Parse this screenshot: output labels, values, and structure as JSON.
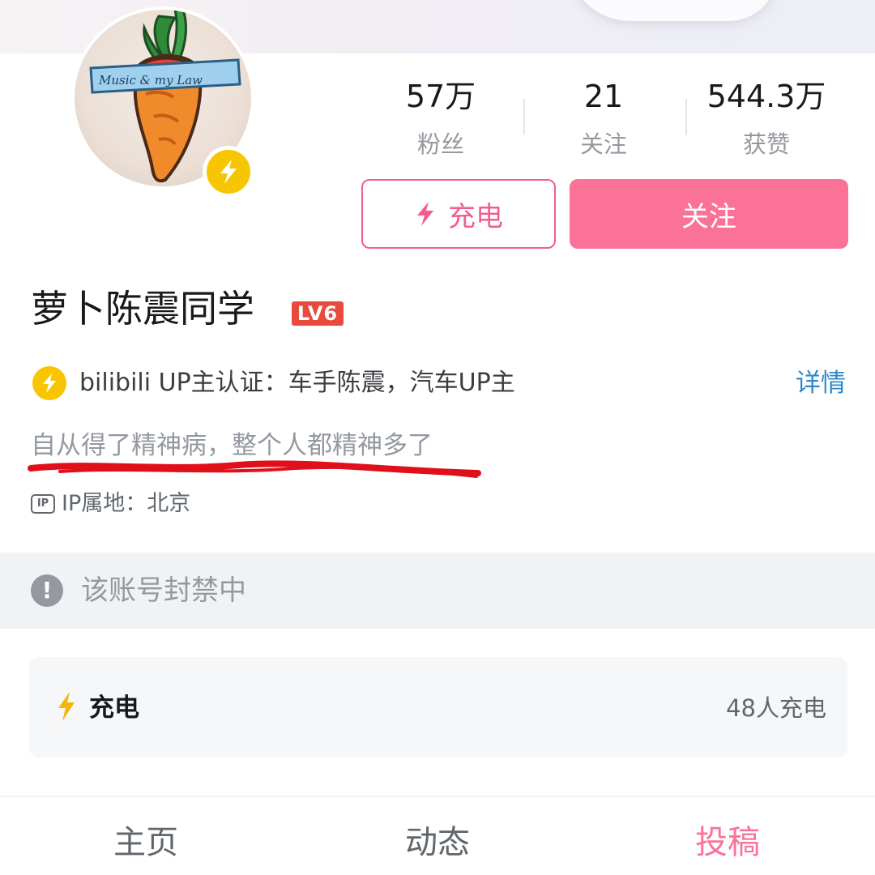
{
  "stats": [
    {
      "value": "57万",
      "label": "粉丝"
    },
    {
      "value": "21",
      "label": "关注"
    },
    {
      "value": "544.3万",
      "label": "获赞"
    }
  ],
  "actions": {
    "charge_label": "充电",
    "follow_label": "关注"
  },
  "profile": {
    "name": "萝卜陈震同学",
    "level": "LV6",
    "verification": "bilibili UP主认证：车手陈震，汽车UP主",
    "details_link": "详情",
    "signature": "自从得了精神病，整个人都精神多了",
    "ip_badge": "IP",
    "ip_location": "IP属地：北京",
    "avatar_text": "Music & my Law"
  },
  "notice": {
    "banned_text": "该账号封禁中",
    "icon": "exclamation-icon"
  },
  "charge_card": {
    "title": "充电",
    "count_text": "48人充电"
  },
  "tabs": [
    {
      "label": "主页",
      "active": false
    },
    {
      "label": "动态",
      "active": false
    },
    {
      "label": "投稿",
      "active": true
    }
  ],
  "colors": {
    "pink": "#fb7299",
    "pink_border": "#f25d8e",
    "link_blue": "#2e88c9",
    "gold": "#f7c600",
    "level_red": "#e94a3e",
    "annotation_red": "#e0101a"
  }
}
